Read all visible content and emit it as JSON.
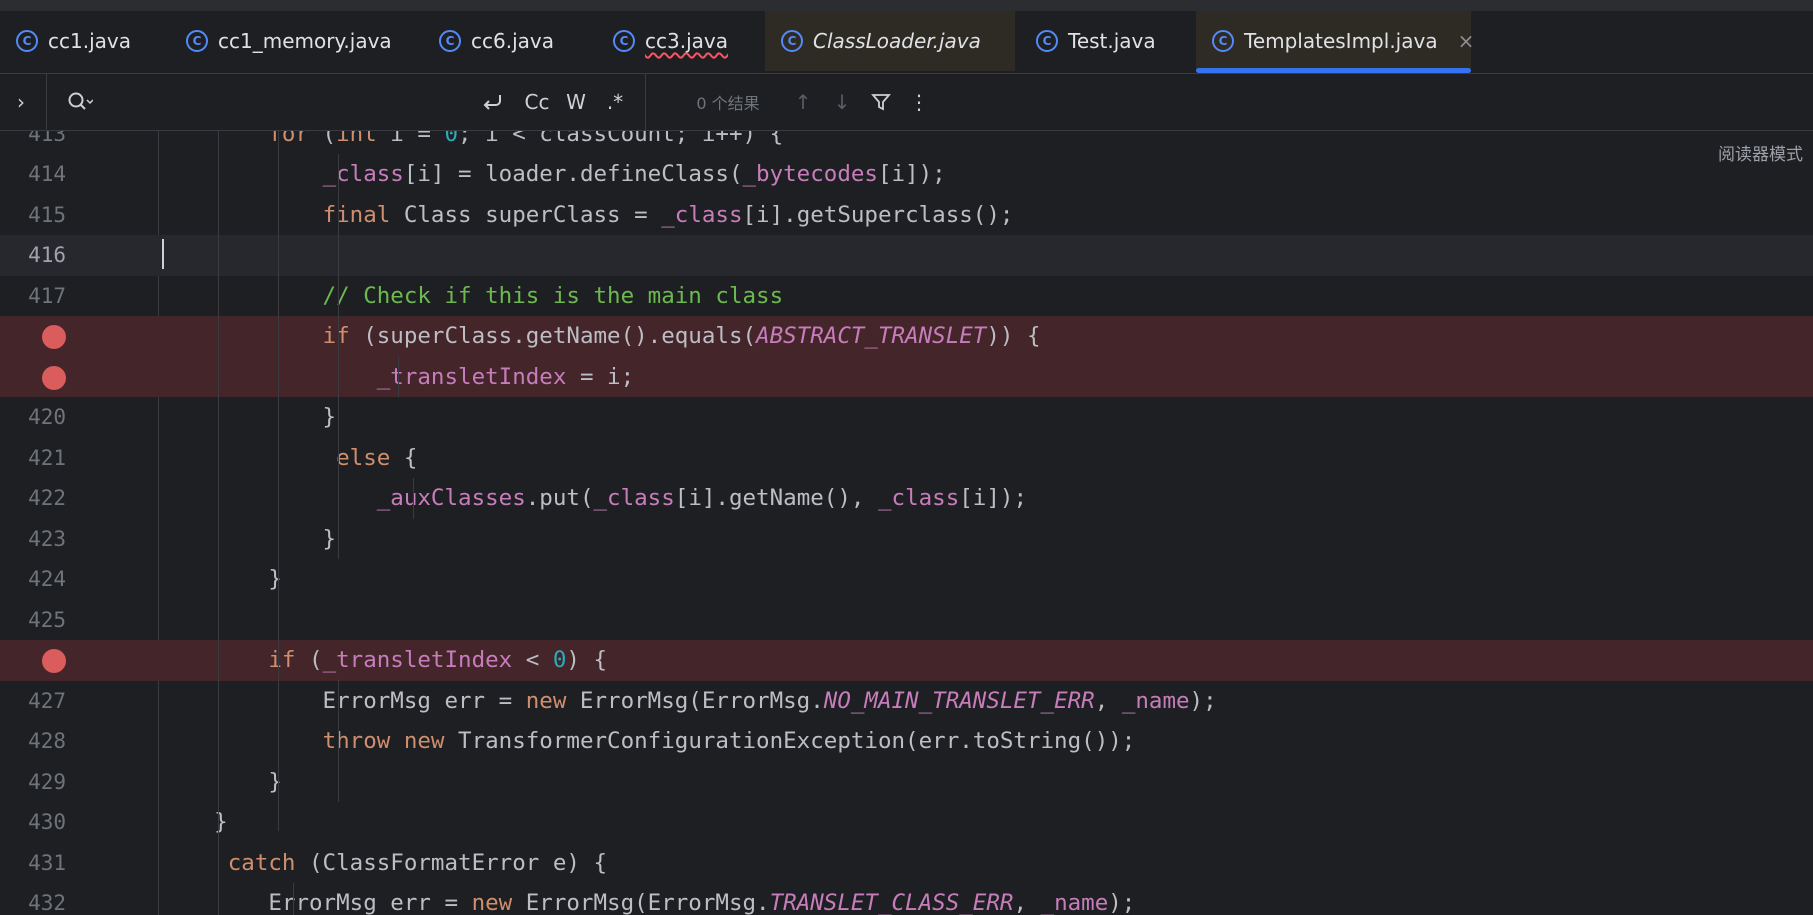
{
  "tabs": [
    {
      "label": "cc1.java",
      "icon": "class-icon"
    },
    {
      "label": "cc1_memory.java",
      "icon": "class-icon"
    },
    {
      "label": "cc6.java",
      "icon": "class-icon"
    },
    {
      "label": "cc3.java",
      "icon": "class-icon"
    },
    {
      "label": "ClassLoader.java",
      "icon": "class-icon"
    },
    {
      "label": "Test.java",
      "icon": "class-icon"
    },
    {
      "label": "TemplatesImpl.java",
      "icon": "class-icon"
    }
  ],
  "active_tab_index": 6,
  "find_bar": {
    "expand": "›",
    "regex_toggle": ".*",
    "case_toggle": "Cc",
    "words_toggle": "W",
    "results": "0 个结果"
  },
  "reader_mode": "阅读器模式",
  "colors": {
    "accent": "#3574f0",
    "breakpoint": "#db5c5c",
    "breakpoint_line": "#43252a",
    "keyword": "#cf8e6d",
    "field": "#c77dbb",
    "comment": "#6cba4f",
    "number": "#2aacb8"
  },
  "lines": [
    {
      "n": "413",
      "text": "        for (int i = 0; i < classCount; i++) {"
    },
    {
      "n": "414",
      "text": "            _class[i] = loader.defineClass(_bytecodes[i]);"
    },
    {
      "n": "415",
      "text": "            final Class superClass = _class[i].getSuperclass();"
    },
    {
      "n": "416",
      "text": ""
    },
    {
      "n": "417",
      "text": "            // Check if this is the main class"
    },
    {
      "n": "",
      "breakpoint": true,
      "text": "            if (superClass.getName().equals(ABSTRACT_TRANSLET)) {"
    },
    {
      "n": "",
      "breakpoint": true,
      "text": "                _transletIndex = i;"
    },
    {
      "n": "420",
      "text": "            }"
    },
    {
      "n": "421",
      "text": "             else {"
    },
    {
      "n": "422",
      "text": "                _auxClasses.put(_class[i].getName(), _class[i]);"
    },
    {
      "n": "423",
      "text": "            }"
    },
    {
      "n": "424",
      "text": "        }"
    },
    {
      "n": "425",
      "text": ""
    },
    {
      "n": "",
      "breakpoint": true,
      "text": "        if (_transletIndex < 0) {"
    },
    {
      "n": "427",
      "text": "            ErrorMsg err = new ErrorMsg(ErrorMsg.NO_MAIN_TRANSLET_ERR, _name);"
    },
    {
      "n": "428",
      "text": "            throw new TransformerConfigurationException(err.toString());"
    },
    {
      "n": "429",
      "text": "        }"
    },
    {
      "n": "430",
      "text": "    }"
    },
    {
      "n": "431",
      "text": "     catch (ClassFormatError e) {"
    },
    {
      "n": "432",
      "text": "        ErrorMsg err = new ErrorMsg(ErrorMsg.TRANSLET_CLASS_ERR, _name);"
    }
  ]
}
